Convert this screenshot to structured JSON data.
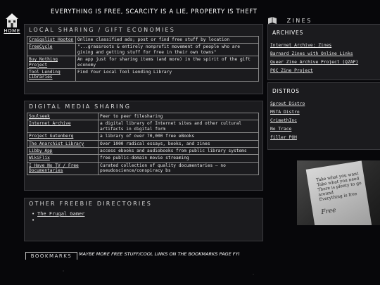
{
  "header": {
    "slogan": "EVERYTHING IS FREE, SCARCITY IS A LIE, PROPERTY IS THEFT",
    "home_label": "HOME"
  },
  "local_sharing": {
    "title": "LOCAL SHARING / GIFT ECONOMIES",
    "rows": [
      {
        "name": "Craigslist Hooton",
        "desc": "Online classified ads; post or find free stuff by location"
      },
      {
        "name": "FreeCycle",
        "desc": "\"...grassroots & entirely nonprofit movement of people who are giving and getting stuff for free in their own towns\""
      },
      {
        "name": "Buy Nothing Project",
        "desc": "An app just for sharing items (and more) in the spirit of the gift economy"
      },
      {
        "name": "Tool Lending Libraries",
        "desc": "Find Your Local Tool Lending Library"
      }
    ]
  },
  "digital_sharing": {
    "title": "DIGITAL MEDIA SHARING",
    "rows": [
      {
        "name": "Soulseek",
        "desc": "Peer to peer filesharing"
      },
      {
        "name": "Internet Archive",
        "desc": "a digital library of Internet sites and other cultural artifacts in digital form"
      },
      {
        "name": "Project Gutenberg",
        "desc": "a library of over 70,000 free eBooks"
      },
      {
        "name": "The Anarchist Library",
        "desc": "Over 1000 radical essays, books, and zines"
      },
      {
        "name": "Libby App",
        "desc": "access ebooks and audiobooks from public library systems"
      },
      {
        "name": "WikiFlix",
        "desc": "free public-domain movie streaming"
      },
      {
        "name": "I Have No TV / Free Documentaries",
        "desc": "Curated collection of quality documentaries — no pseudoscience/conspiracy bs"
      }
    ]
  },
  "other_freebies": {
    "title": "OTHER FREEBIE DIRECTORIES",
    "items": [
      "The Frugal Gamer",
      "",
      ""
    ]
  },
  "bookmarks": {
    "title": "BOOKMARKS",
    "note": "MAYBE MORE FREE STUFF/COOL LINKS ON THE BOOKMARKS PAGE FYI"
  },
  "zines": {
    "title": "ZINES",
    "archives": {
      "heading": "ARCHIVES",
      "links": [
        "Internet Archive: Zines",
        "Barnard Zines with Online Links",
        "Queer Zine Archive Project (QZAP)",
        "POC Zine Project"
      ]
    },
    "distros": {
      "heading": "DISTROS",
      "links": [
        "Sprout Distro",
        "MSTA Distro",
        "CrimethInc",
        "No Trace",
        "filler POH"
      ]
    }
  },
  "photo": {
    "text_lines": [
      "Take what you want",
      "Take what you need",
      "There is plenty to go around",
      "Everything is free"
    ],
    "title": "Free"
  }
}
